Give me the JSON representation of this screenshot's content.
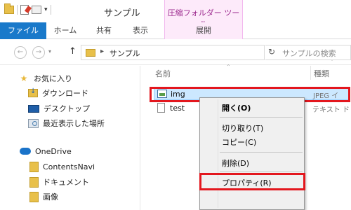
{
  "window": {
    "title": "サンプル",
    "context_tab_title": "圧縮フォルダー ツール"
  },
  "ribbon": {
    "tabs": [
      "ファイル",
      "ホーム",
      "共有",
      "表示",
      "展開"
    ]
  },
  "address": {
    "path": "サンプル",
    "search_placeholder": "サンプルの検索"
  },
  "navpane": {
    "favorites_label": "お気に入り",
    "favorites": [
      "ダウンロード",
      "デスクトップ",
      "最近表示した場所"
    ],
    "onedrive_label": "OneDrive",
    "onedrive_items": [
      "ContentsNavi",
      "ドキュメント",
      "画像"
    ]
  },
  "content": {
    "columns": {
      "name": "名前",
      "type": "種類"
    },
    "files": [
      {
        "name": "img",
        "type": "JPEG イ"
      },
      {
        "name": "test",
        "type": "テキスト ド"
      }
    ]
  },
  "context_menu": {
    "items": [
      "開く(O)",
      "切り取り(T)",
      "コピー(C)",
      "削除(D)",
      "プロパティ(R)"
    ]
  },
  "colors": {
    "accent": "#1979ca",
    "highlight_box": "#e3171e",
    "selection": "#cce8ff"
  }
}
